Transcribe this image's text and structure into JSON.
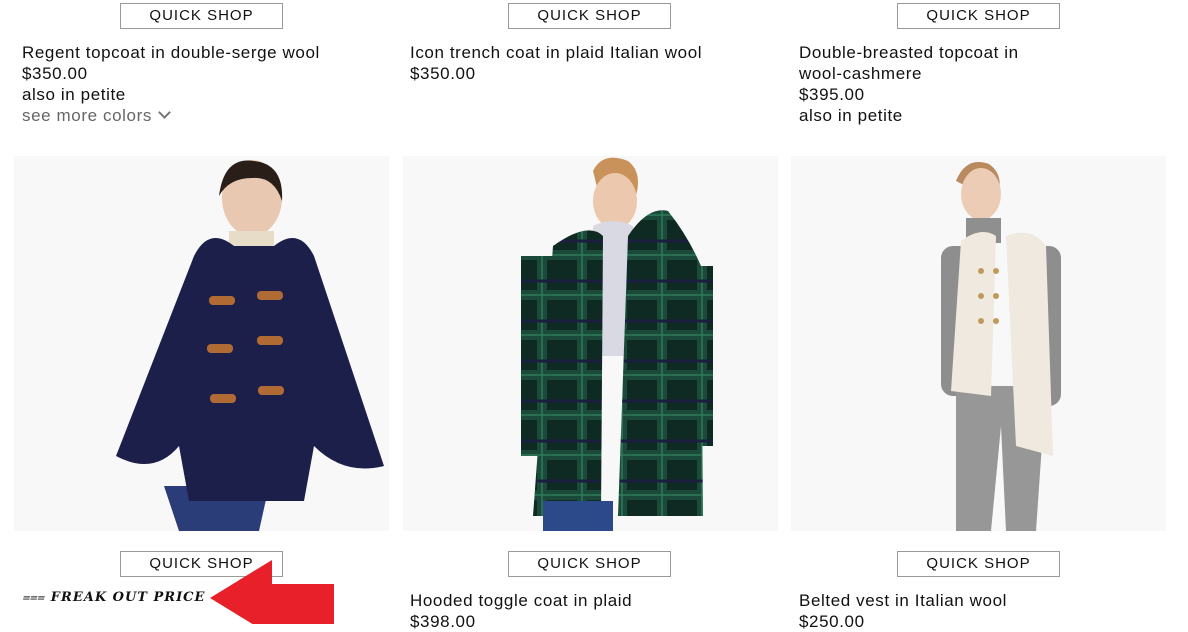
{
  "quick_shop_label": "QUICK SHOP",
  "top_row": [
    {
      "name": "Regent topcoat in double-serge wool",
      "price": "$350.00",
      "petite": "also in petite",
      "colors": "see more colors"
    },
    {
      "name": "Icon trench coat in plaid Italian wool",
      "price": "$350.00"
    },
    {
      "name_line1": "Double-breasted topcoat in",
      "name_line2": "wool-cashmere",
      "price": "$395.00",
      "petite": "also in petite"
    }
  ],
  "bottom_row": [
    {
      "badge": "FREAK OUT PRICE",
      "image_alt": "Model wearing navy toggle cape with striped sweater"
    },
    {
      "name": "Hooded toggle coat in plaid",
      "price": "$398.00",
      "image_alt": "Model wearing hooded plaid toggle coat"
    },
    {
      "name": "Belted vest in Italian wool",
      "price": "$250.00",
      "image_alt": "Model wearing ivory belted vest over grey knit"
    }
  ],
  "colors": {
    "arrow": "#e8202a",
    "cape": "#1b1f4a",
    "plaid": "#1d3b2c",
    "vest": "#efe9df"
  },
  "icons": {
    "chevron": "chevron-down-icon",
    "arrow": "arrow-left-icon"
  }
}
